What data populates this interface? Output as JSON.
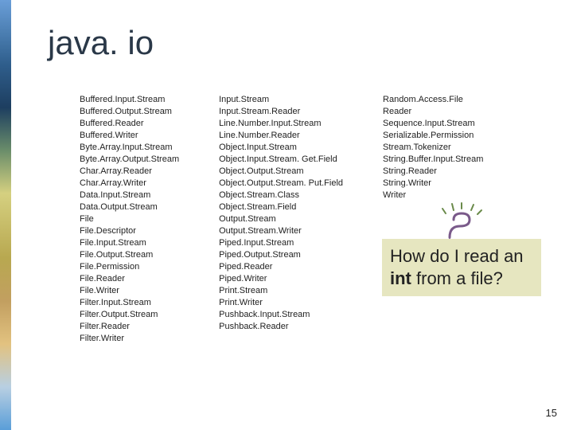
{
  "title": "java. io",
  "columns": [
    [
      "Buffered.Input.Stream",
      "Buffered.Output.Stream",
      "Buffered.Reader",
      "Buffered.Writer",
      "Byte.Array.Input.Stream",
      "Byte.Array.Output.Stream",
      "Char.Array.Reader",
      "Char.Array.Writer",
      "Data.Input.Stream",
      "Data.Output.Stream",
      "File",
      "File.Descriptor",
      "File.Input.Stream",
      "File.Output.Stream",
      "File.Permission",
      "File.Reader",
      "File.Writer",
      "Filter.Input.Stream",
      "Filter.Output.Stream",
      "Filter.Reader",
      "Filter.Writer"
    ],
    [
      "Input.Stream",
      "Input.Stream.Reader",
      "Line.Number.Input.Stream",
      "Line.Number.Reader",
      "Object.Input.Stream",
      "Object.Input.Stream. Get.Field",
      "Object.Output.Stream",
      "Object.Output.Stream. Put.Field",
      "Object.Stream.Class",
      "Object.Stream.Field",
      "Output.Stream",
      "Output.Stream.Writer",
      "Piped.Input.Stream",
      "Piped.Output.Stream",
      "Piped.Reader",
      "Piped.Writer",
      "Print.Stream",
      "Print.Writer",
      "Pushback.Input.Stream",
      "Pushback.Reader"
    ],
    [
      "Random.Access.File",
      "Reader",
      "Sequence.Input.Stream",
      "Serializable.Permission",
      "Stream.Tokenizer",
      "String.Buffer.Input.Stream",
      "String.Reader",
      "String.Writer",
      "Writer"
    ]
  ],
  "question": {
    "pre": "How do I read an ",
    "bold": "int",
    "post": " from a file?"
  },
  "pageNumber": "15"
}
